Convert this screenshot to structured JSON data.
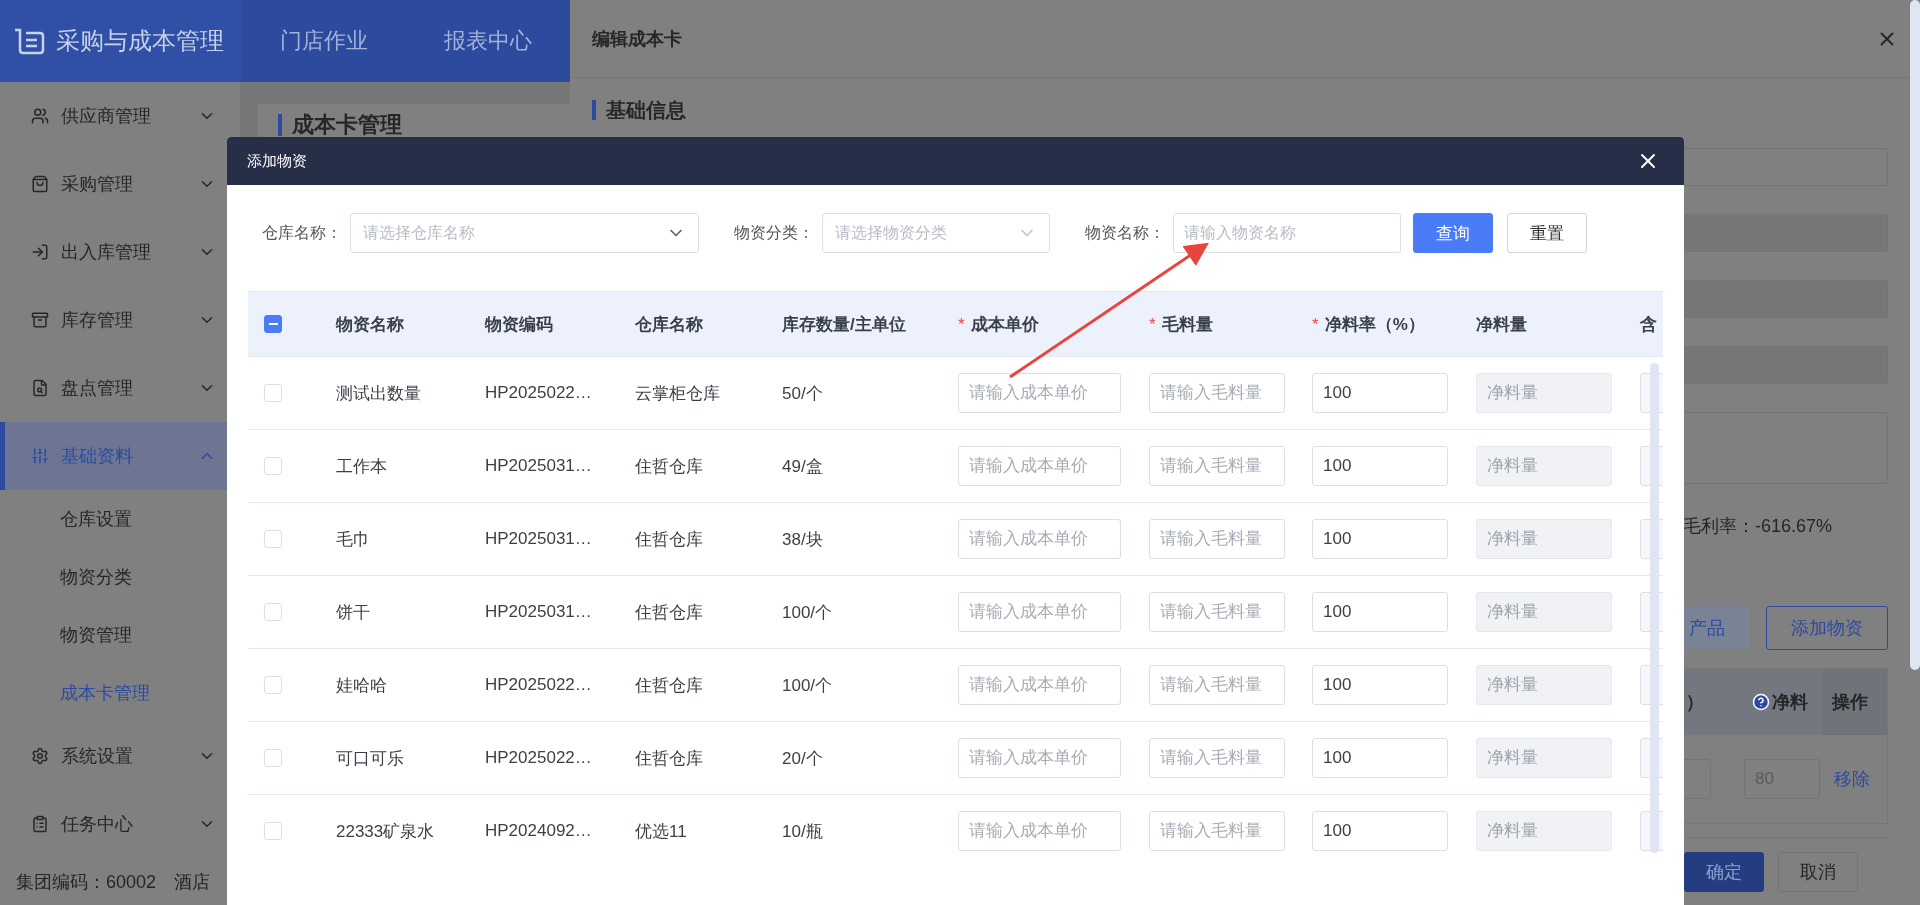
{
  "app": {
    "title": "采购与成本管理",
    "nav": [
      {
        "label": "门店作业",
        "selected": false
      },
      {
        "label": "报表中心",
        "selected": false
      }
    ]
  },
  "sidebar": {
    "items": [
      {
        "label": "供应商管理",
        "expanded": false,
        "selected": false
      },
      {
        "label": "采购管理",
        "expanded": false,
        "selected": false
      },
      {
        "label": "出入库管理",
        "expanded": false,
        "selected": false
      },
      {
        "label": "库存管理",
        "expanded": false,
        "selected": false
      },
      {
        "label": "盘点管理",
        "expanded": false,
        "selected": false
      },
      {
        "label": "基础资料",
        "expanded": true,
        "selected": true,
        "children": [
          {
            "label": "仓库设置",
            "selected": false
          },
          {
            "label": "物资分类",
            "selected": false
          },
          {
            "label": "物资管理",
            "selected": false
          },
          {
            "label": "成本卡管理",
            "selected": true
          }
        ]
      },
      {
        "label": "系统设置",
        "expanded": false,
        "selected": false
      },
      {
        "label": "任务中心",
        "expanded": false,
        "selected": false
      }
    ]
  },
  "page": {
    "title": "成本卡管理"
  },
  "status_bar": {
    "group_code": "集团编码：60002",
    "hotel": "酒店"
  },
  "drawer": {
    "title": "编辑成本卡",
    "section": "基础信息",
    "gross_margin": "毛利率：-616.67%",
    "buttons": [
      {
        "label": "产品",
        "kind": "plain"
      },
      {
        "label": "添加物资",
        "kind": "outline"
      }
    ],
    "table": {
      "columns": [
        "）",
        "净料",
        "操作"
      ],
      "rows": [
        {
          "value": "80",
          "action": "移除"
        }
      ]
    },
    "footer": [
      {
        "label": "确定",
        "kind": "primary"
      },
      {
        "label": "取消",
        "kind": "default"
      }
    ]
  },
  "dialog": {
    "title": "添加物资",
    "filters": [
      {
        "label": "仓库名称：",
        "placeholder": "请选择仓库名称",
        "kind": "select"
      },
      {
        "label": "物资分类：",
        "placeholder": "请选择物资分类",
        "kind": "select"
      },
      {
        "label": "物资名称：",
        "placeholder": "请输入物资名称",
        "kind": "input"
      }
    ],
    "buttons": [
      {
        "label": "查询",
        "kind": "primary"
      },
      {
        "label": "重置",
        "kind": "default"
      }
    ],
    "table": {
      "select_all": {
        "indeterminate": true
      },
      "columns": [
        {
          "label": "物资名称",
          "required": false
        },
        {
          "label": "物资编码",
          "required": false
        },
        {
          "label": "仓库名称",
          "required": false
        },
        {
          "label": "库存数量/主单位",
          "required": false
        },
        {
          "label": "成本单价",
          "required": true,
          "mark": "*"
        },
        {
          "label": "毛料量",
          "required": true,
          "mark": "*"
        },
        {
          "label": "净料率（%）",
          "required": true,
          "mark": "*"
        },
        {
          "label": "净料量",
          "required": false
        },
        {
          "label": "含",
          "required": false
        }
      ],
      "rows": [
        {
          "checked": false,
          "name": "测试出数量",
          "code": "HP2025022…",
          "warehouse": "云掌柜仓库",
          "stock": "50/个",
          "cost_price_placeholder": "请输入成本单价",
          "gross_placeholder": "请输入毛料量",
          "yield": "100",
          "net": {
            "placeholder": "净料量",
            "disabled": true
          }
        },
        {
          "checked": false,
          "name": "工作本",
          "code": "HP2025031…",
          "warehouse": "住哲仓库",
          "stock": "49/盒",
          "cost_price_placeholder": "请输入成本单价",
          "gross_placeholder": "请输入毛料量",
          "yield": "100",
          "net": {
            "placeholder": "净料量",
            "disabled": true
          }
        },
        {
          "checked": false,
          "name": "毛巾",
          "code": "HP2025031…",
          "warehouse": "住哲仓库",
          "stock": "38/块",
          "cost_price_placeholder": "请输入成本单价",
          "gross_placeholder": "请输入毛料量",
          "yield": "100",
          "net": {
            "placeholder": "净料量",
            "disabled": true
          }
        },
        {
          "checked": false,
          "name": "饼干",
          "code": "HP2025031…",
          "warehouse": "住哲仓库",
          "stock": "100/个",
          "cost_price_placeholder": "请输入成本单价",
          "gross_placeholder": "请输入毛料量",
          "yield": "100",
          "net": {
            "placeholder": "净料量",
            "disabled": true
          }
        },
        {
          "checked": false,
          "name": "娃哈哈",
          "code": "HP2025022…",
          "warehouse": "住哲仓库",
          "stock": "100/个",
          "cost_price_placeholder": "请输入成本单价",
          "gross_placeholder": "请输入毛料量",
          "yield": "100",
          "net": {
            "placeholder": "净料量",
            "disabled": true
          }
        },
        {
          "checked": false,
          "name": "可口可乐",
          "code": "HP2025022…",
          "warehouse": "住哲仓库",
          "stock": "20/个",
          "cost_price_placeholder": "请输入成本单价",
          "gross_placeholder": "请输入毛料量",
          "yield": "100",
          "net": {
            "placeholder": "净料量",
            "disabled": true
          }
        },
        {
          "checked": false,
          "name": "22333矿泉水",
          "code": "HP2024092…",
          "warehouse": "优选11",
          "stock": "10/瓶",
          "cost_price_placeholder": "请输入成本单价",
          "gross_placeholder": "请输入毛料量",
          "yield": "100",
          "net": {
            "placeholder": "净料量",
            "disabled": true
          }
        }
      ]
    }
  }
}
